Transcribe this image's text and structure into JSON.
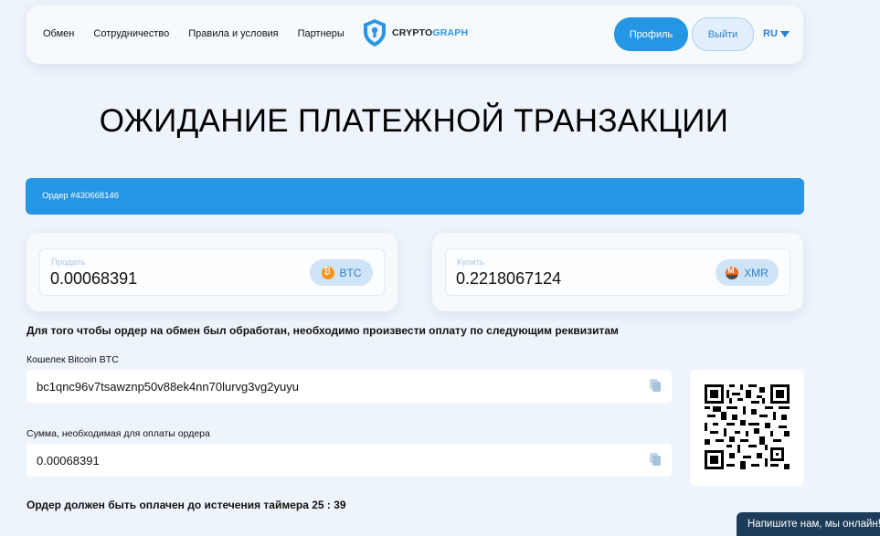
{
  "header": {
    "nav": [
      "Обмен",
      "Сотрудничество",
      "Правила и условия",
      "Партнеры"
    ],
    "logo_main": "CRYPTO",
    "logo_accent": "GRAPH",
    "profile_label": "Профиль",
    "logout_label": "Выйти",
    "language": "RU"
  },
  "title": "ОЖИДАНИЕ ПЛАТЕЖНОЙ ТРАНЗАКЦИИ",
  "order": {
    "label": "Ордер #430668146"
  },
  "sell": {
    "label": "Продать",
    "value": "0.00068391",
    "currency": "BTC",
    "icon": "bitcoin-icon",
    "color": "#f7931a"
  },
  "buy": {
    "label": "Купить",
    "value": "0.2218067124",
    "currency": "XMR",
    "icon": "monero-icon",
    "color": "#f26822"
  },
  "instruction": "Для того чтобы ордер на обмен был обработан, необходимо произвести оплату по следующим реквизитам",
  "wallet": {
    "label": "Кошелек Bitcoin BTC",
    "value": "bc1qnc96v7tsawznp50v88ek4nn70lurvg3vg2yuyu"
  },
  "amount": {
    "label": "Сумма, необходимая для оплаты ордера",
    "value": "0.00068391"
  },
  "timer": {
    "text": "Ордер должен быть оплачен до истечения таймера 25 : 39"
  },
  "chat": {
    "label": "Напишите нам, мы онлайн!"
  },
  "colors": {
    "accent": "#2596e4",
    "background": "#eef4fb",
    "chat": "#1d3c59"
  }
}
